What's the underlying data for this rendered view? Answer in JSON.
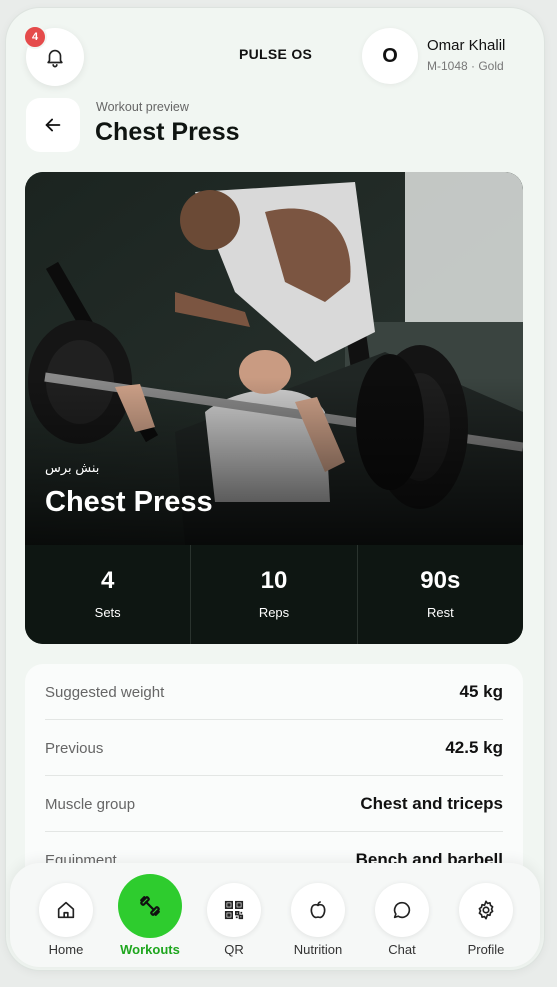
{
  "header": {
    "brand": "PULSE OS",
    "notification_count": "4",
    "avatar_letter": "O",
    "user_name": "Omar Khalil",
    "user_meta": "M-1048 · Gold"
  },
  "page": {
    "breadcrumb": "Workout preview",
    "title": "Chest Press"
  },
  "hero": {
    "arabic_title": "بنش برس",
    "title": "Chest Press"
  },
  "stats": [
    {
      "value": "4",
      "label": "Sets"
    },
    {
      "value": "10",
      "label": "Reps"
    },
    {
      "value": "90s",
      "label": "Rest"
    }
  ],
  "details": [
    {
      "key": "Suggested weight",
      "value": "45 kg"
    },
    {
      "key": "Previous",
      "value": "42.5 kg"
    },
    {
      "key": "Muscle group",
      "value": "Chest and triceps"
    },
    {
      "key": "Equipment",
      "value": "Bench and barbell"
    }
  ],
  "nav": [
    {
      "label": "Home",
      "icon": "home-icon"
    },
    {
      "label": "Workouts",
      "icon": "dumbbell-icon",
      "active": true
    },
    {
      "label": "QR",
      "icon": "qr-icon"
    },
    {
      "label": "Nutrition",
      "icon": "apple-icon"
    },
    {
      "label": "Chat",
      "icon": "chat-icon"
    },
    {
      "label": "Profile",
      "icon": "gear-icon"
    }
  ],
  "colors": {
    "accent": "#2ecc2e",
    "dark_panel": "#0e1612",
    "badge": "#e54b4b"
  }
}
